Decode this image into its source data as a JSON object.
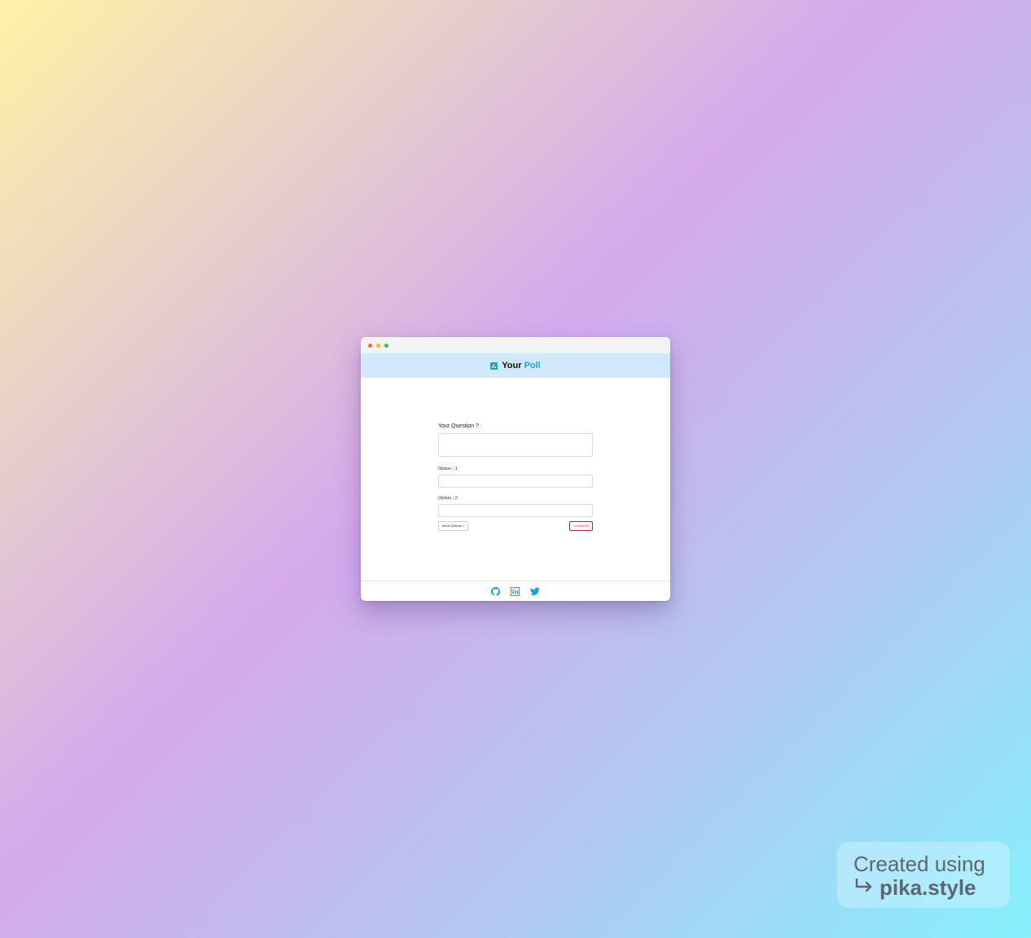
{
  "window": {
    "controls": [
      "close",
      "minimize",
      "maximize"
    ],
    "control_colors": {
      "close": "#ff5f57",
      "minimize": "#febc2e",
      "maximize": "#28c840"
    }
  },
  "header": {
    "brand_word_1": "Your",
    "brand_word_2": "Poll",
    "logo_icon": "bar-chart-icon",
    "accent_color": "#1a9fd9",
    "background_color": "#cfe8fa"
  },
  "form": {
    "question_label": "Your Question ?",
    "question_value": "",
    "options": [
      {
        "label": "Option : 1",
        "value": ""
      },
      {
        "label": "Option : 2",
        "value": ""
      }
    ],
    "more_options_label": "More Options +",
    "create_poll_label": "CreatePoll"
  },
  "footer": {
    "icons": [
      "github-icon",
      "linkedin-icon",
      "twitter-icon"
    ]
  },
  "watermark": {
    "line1": "Created using",
    "line2": "pika.style",
    "icon": "arrow-return-icon"
  }
}
